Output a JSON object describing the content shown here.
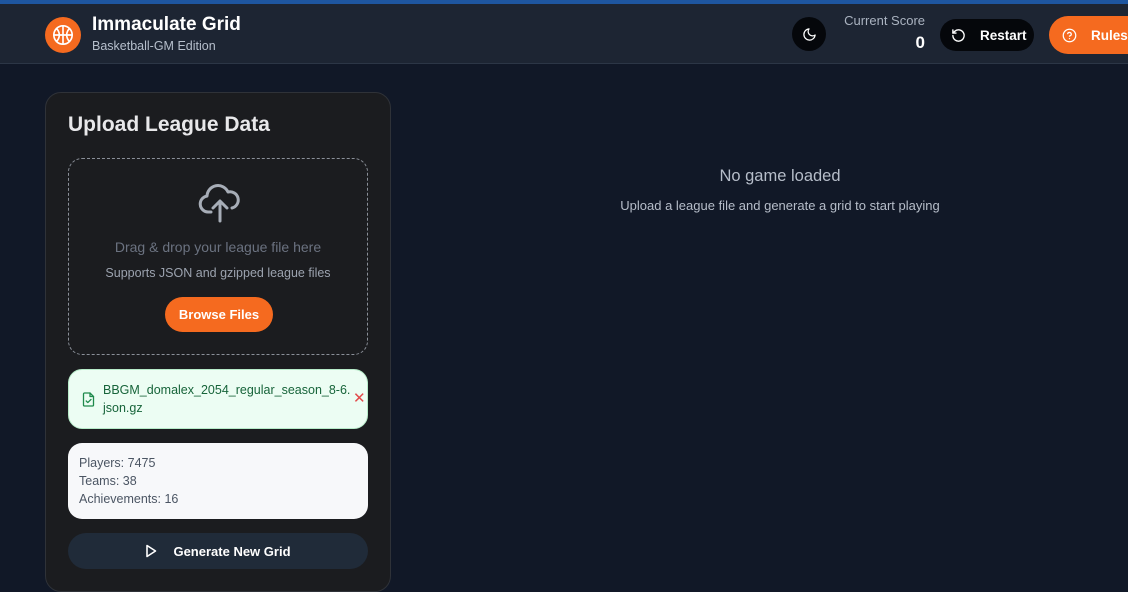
{
  "header": {
    "title": "Immaculate Grid",
    "subtitle": "Basketball-GM Edition",
    "score_label": "Current Score",
    "score_value": "0",
    "restart_label": "Restart",
    "rules_label": "Rules",
    "icons": {
      "logo": "basketball-icon",
      "theme": "moon-icon",
      "restart": "rotate-ccw-icon",
      "rules": "help-circle-icon"
    }
  },
  "upload_panel": {
    "title": "Upload League Data",
    "dropzone": {
      "icon": "cloud-upload-icon",
      "text": "Drag & drop your league file here",
      "support_text": "Supports JSON and gzipped league files",
      "browse_label": "Browse Files"
    },
    "file": {
      "icon": "file-check-icon",
      "name": "BBGM_domalex_2054_regular_season_8-6.json.gz",
      "remove_icon": "close-icon"
    },
    "stats": {
      "players": "Players: 7475",
      "teams": "Teams: 38",
      "achievements": "Achievements: 16"
    },
    "generate": {
      "icon": "play-icon",
      "label": "Generate New Grid"
    }
  },
  "main": {
    "empty_title": "No game loaded",
    "empty_subtitle": "Upload a league file and generate a grid to start playing"
  },
  "colors": {
    "background": "#111827",
    "header": "#1d2533",
    "accent_orange": "#f56a1f",
    "panel": "#1b1c1f",
    "file_card": "#ecfdf3",
    "file_text": "#17643a",
    "remove": "#e24b4b"
  }
}
